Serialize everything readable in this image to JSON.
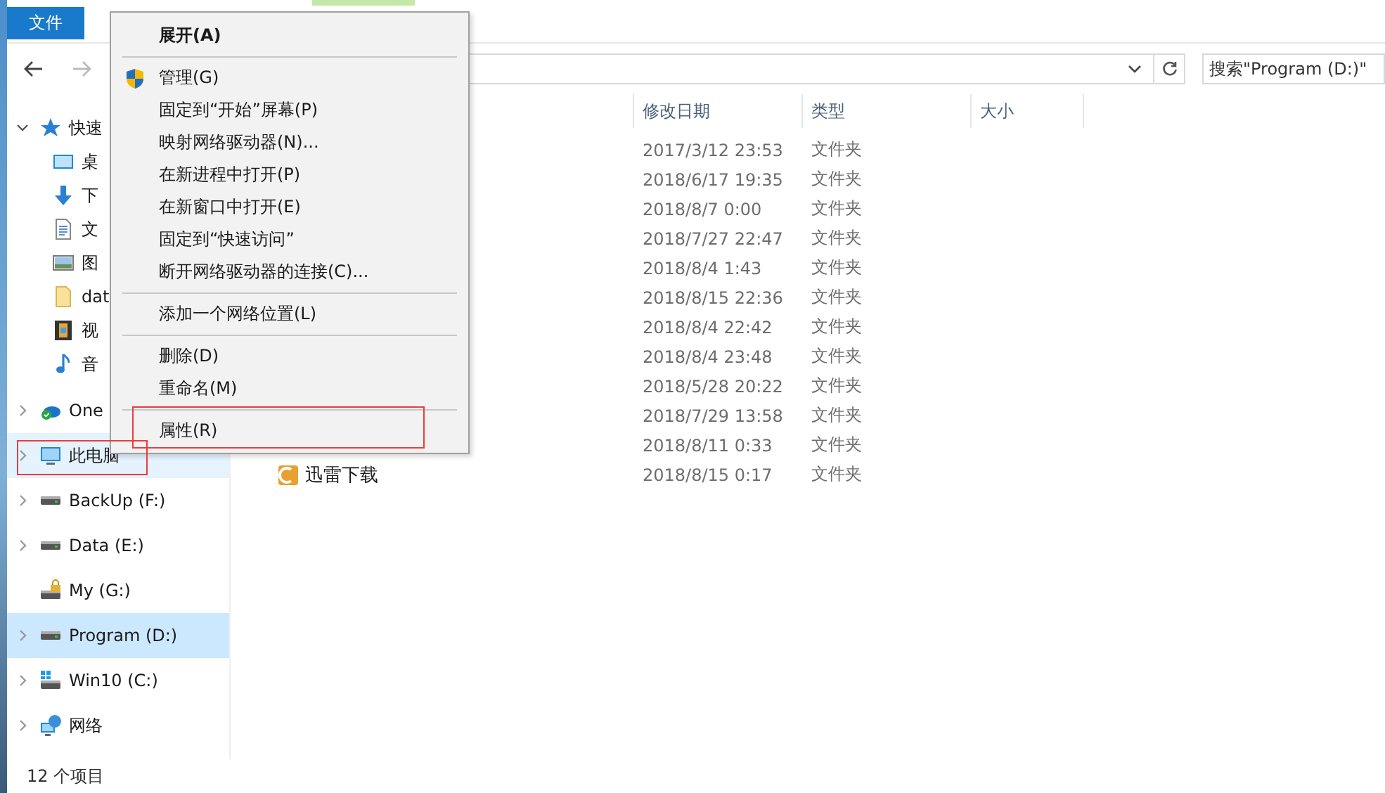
{
  "ribbon": {
    "tabs": [
      {
        "label": "文件",
        "selected": true
      }
    ]
  },
  "search": {
    "placeholder": "搜索\"Program (D:)\""
  },
  "sidebar": {
    "items": [
      {
        "label": "快速",
        "expanded": true,
        "selected": false,
        "hovered": false,
        "children": [
          {
            "label": "桌"
          },
          {
            "label": "下"
          },
          {
            "label": "文"
          },
          {
            "label": "图"
          },
          {
            "label": "dat"
          },
          {
            "label": "视"
          },
          {
            "label": "音"
          }
        ]
      },
      {
        "label": "One",
        "expanded": false,
        "selected": false,
        "hovered": false
      },
      {
        "label": "此电脑",
        "expanded": false,
        "selected": false,
        "hovered": true
      },
      {
        "label": "BackUp (F:)",
        "expanded": false,
        "selected": false,
        "hovered": false
      },
      {
        "label": "Data (E:)",
        "expanded": false,
        "selected": false,
        "hovered": false
      },
      {
        "label": "My (G:)",
        "selected": false,
        "hovered": false
      },
      {
        "label": "Program (D:)",
        "expanded": false,
        "selected": true,
        "hovered": false
      },
      {
        "label": "Win10 (C:)",
        "expanded": false,
        "selected": false,
        "hovered": false
      },
      {
        "label": "网络",
        "expanded": false,
        "selected": false,
        "hovered": false
      }
    ]
  },
  "table": {
    "columns": [
      "修改日期",
      "类型",
      "大小"
    ],
    "rows": [
      {
        "date": "2017/3/12 23:53",
        "type": "文件夹"
      },
      {
        "date": "2018/6/17 19:35",
        "type": "文件夹"
      },
      {
        "date": "2018/8/7 0:00",
        "type": "文件夹"
      },
      {
        "date": "2018/7/27 22:47",
        "type": "文件夹"
      },
      {
        "date": "2018/8/4 1:43",
        "type": "文件夹"
      },
      {
        "date": "2018/8/15 22:36",
        "type": "文件夹"
      },
      {
        "date": "2018/8/4 22:42",
        "type": "文件夹"
      },
      {
        "date": "2018/8/4 23:48",
        "type": "文件夹"
      },
      {
        "date": "2018/5/28 20:22",
        "type": "文件夹"
      },
      {
        "date": "2018/7/29 13:58",
        "type": "文件夹"
      },
      {
        "date": "2018/8/11 0:33",
        "type": "文件夹"
      },
      {
        "name": "迅雷下载",
        "date": "2018/8/15 0:17",
        "type": "文件夹"
      }
    ]
  },
  "context_menu": {
    "groups": [
      [
        {
          "label": "展开(A)",
          "default": true
        }
      ],
      [
        {
          "label": "管理(G)",
          "default": false
        },
        {
          "label": "固定到“开始”屏幕(P)",
          "default": false
        },
        {
          "label": "映射网络驱动器(N)...",
          "default": false
        },
        {
          "label": "在新进程中打开(P)",
          "default": false
        },
        {
          "label": "在新窗口中打开(E)",
          "default": false
        },
        {
          "label": "固定到“快速访问”",
          "default": false
        },
        {
          "label": "断开网络驱动器的连接(C)...",
          "default": false
        }
      ],
      [
        {
          "label": "添加一个网络位置(L)",
          "default": false
        }
      ],
      [
        {
          "label": "删除(D)",
          "default": false
        },
        {
          "label": "重命名(M)",
          "default": false
        }
      ],
      [
        {
          "label": "属性(R)",
          "default": false
        }
      ]
    ]
  },
  "status_bar": {
    "text": "12 个项目"
  }
}
